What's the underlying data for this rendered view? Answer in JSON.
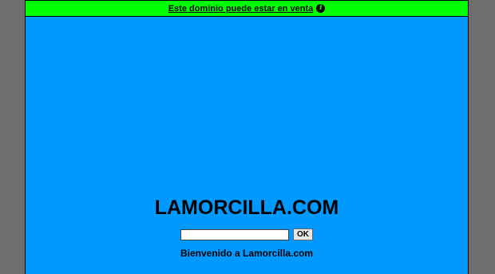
{
  "banner": {
    "link_text": "Este dominio puede estar en venta",
    "info_icon": "info-icon",
    "info_glyph": "i",
    "background_color": "#00ff00"
  },
  "main": {
    "title": "LAMORCILLA.COM",
    "background_color": "#0099ff",
    "search": {
      "value": "",
      "placeholder": ""
    },
    "ok_label": "OK",
    "welcome_text": "Bienvenido a Lamorcilla.com"
  }
}
